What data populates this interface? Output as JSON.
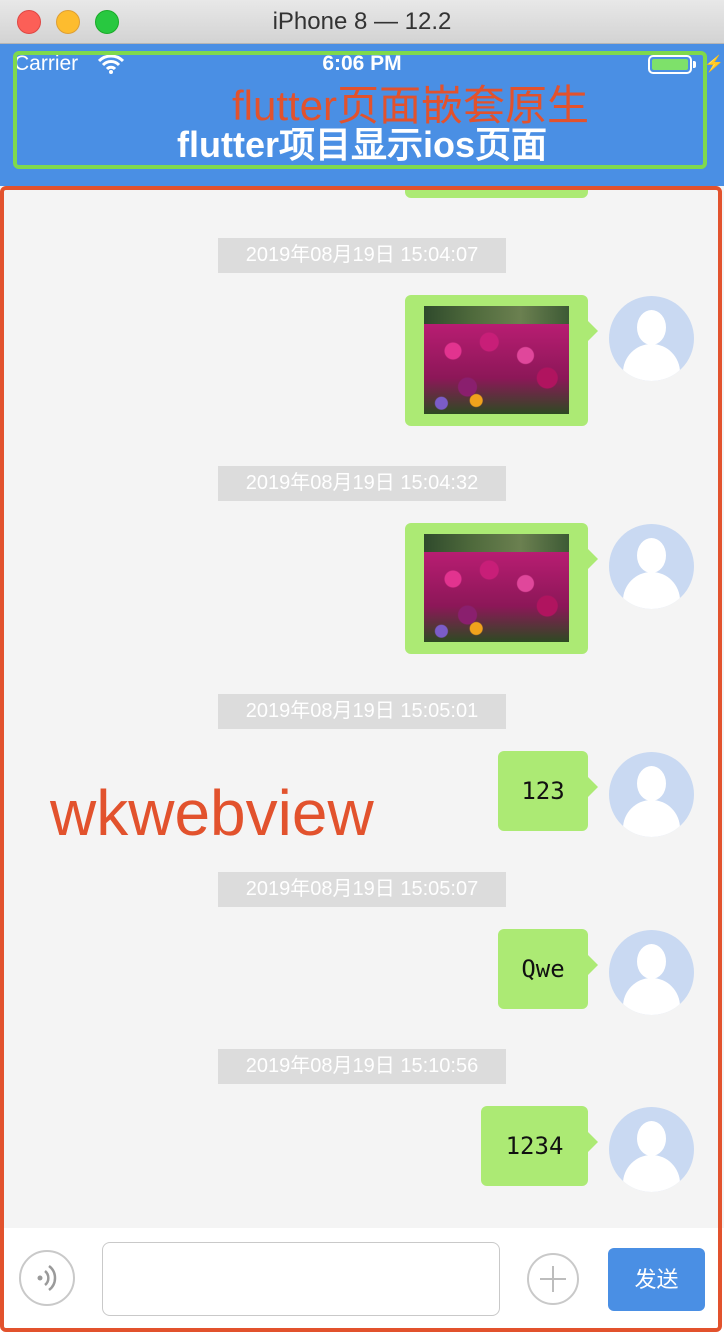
{
  "window": {
    "title": "iPhone 8 — 12.2"
  },
  "status_bar": {
    "carrier": "Carrier",
    "time": "6:06 PM"
  },
  "nav": {
    "title": "flutter项目显示ios页面"
  },
  "annotations": {
    "flutter_label": "flutter页面嵌套原生",
    "webview_label": "wkwebview",
    "color": "#e2522d",
    "flutter_box_color": "#7fd94c"
  },
  "messages": [
    {
      "timestamp": "2019年08月19日 15:04:07",
      "type": "image",
      "content_icon": "flower-photo"
    },
    {
      "timestamp": "2019年08月19日 15:04:32",
      "type": "image",
      "content_icon": "flower-photo"
    },
    {
      "timestamp": "2019年08月19日 15:05:01",
      "type": "text",
      "text": "123"
    },
    {
      "timestamp": "2019年08月19日 15:05:07",
      "type": "text",
      "text": "Qwe"
    },
    {
      "timestamp": "2019年08月19日 15:10:56",
      "type": "text",
      "text": "1234"
    }
  ],
  "input_bar": {
    "input_value": "",
    "send_label": "发送",
    "voice_icon": "voice-icon",
    "plus_icon": "plus-icon"
  },
  "colors": {
    "nav_blue": "#4a8fe4",
    "bubble_green": "#acea74",
    "chat_bg": "#f4f4f4"
  }
}
